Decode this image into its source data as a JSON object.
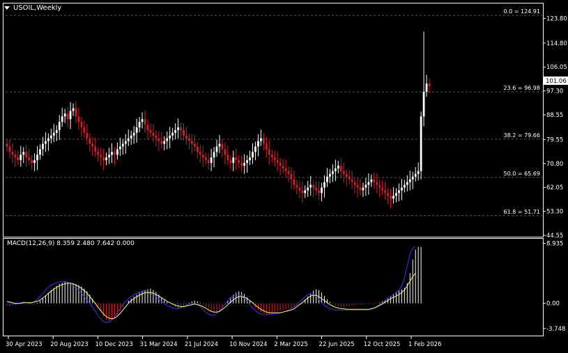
{
  "chart_title": "USOIL,Weekly",
  "macd_label": "MACD(12,26,9) 8.359 2.480 7.642 0.000",
  "colors": {
    "background": "#000000",
    "bull": "#ffffff",
    "bear": "#d0202a",
    "macd_line": "#2a3cff",
    "signal_line": "#ffff66",
    "grid": "#ffffff",
    "current_price_box": "#ffffff"
  },
  "chart_data": [
    {
      "type": "candlestick",
      "title": "USOIL,Weekly",
      "y_ticks": [
        "123.80",
        "114.80",
        "106.05",
        "97.30",
        "88.55",
        "79.55",
        "70.80",
        "62.05",
        "53.30",
        "44.55"
      ],
      "ylim": [
        44.55,
        128.5
      ],
      "current_price": "101.06",
      "x_ticks": [
        "30 Apr 2023",
        "20 Aug 2023",
        "10 Dec 2023",
        "31 Mar 2024",
        "21 Jul 2024",
        "10 Nov 2024",
        "2 Mar 2025",
        "22 Jun 2025",
        "12 Oct 2025",
        "1 Feb 2026"
      ],
      "fibonacci_levels": [
        {
          "label": "0.0 = 124.91",
          "value": 124.91
        },
        {
          "label": "23.6 = 96.98",
          "value": 96.98
        },
        {
          "label": "38.2 = 79.66",
          "value": 79.66
        },
        {
          "label": "50.0 = 65.69",
          "value": 65.69
        },
        {
          "label": "61.8 = 51.71",
          "value": 51.71
        }
      ],
      "close": [
        77,
        75,
        74,
        73,
        72,
        74,
        75,
        73,
        72,
        71,
        72,
        74,
        76,
        78,
        79,
        80,
        81,
        82,
        83,
        86,
        88,
        89,
        87,
        90,
        91,
        88,
        86,
        84,
        82,
        80,
        78,
        77,
        75,
        74,
        73,
        72,
        73,
        74,
        75,
        74,
        76,
        77,
        78,
        79,
        80,
        81,
        82,
        84,
        86,
        87,
        85,
        83,
        82,
        81,
        80,
        79,
        78,
        79,
        80,
        81,
        82,
        83,
        84,
        83,
        81,
        80,
        79,
        78,
        77,
        75,
        74,
        73,
        72,
        71,
        73,
        75,
        77,
        78,
        76,
        74,
        72,
        71,
        73,
        72,
        71,
        70,
        71,
        72,
        73,
        75,
        77,
        79,
        80,
        78,
        76,
        74,
        73,
        72,
        71,
        70,
        69,
        68,
        67,
        65,
        63,
        62,
        61,
        60,
        61,
        62,
        63,
        62,
        61,
        60,
        62,
        64,
        66,
        67,
        68,
        69,
        70,
        68,
        67,
        66,
        65,
        64,
        63,
        62,
        61,
        62,
        63,
        64,
        65,
        64,
        63,
        62,
        61,
        60,
        59,
        58,
        59,
        60,
        61,
        62,
        63,
        64,
        65,
        66,
        67,
        68,
        88,
        97,
        100,
        99
      ],
      "spikes": {
        "151": 119,
        "152": 102
      }
    },
    {
      "type": "macd",
      "parameters": "MACD(12,26,9)",
      "values": {
        "histogram": 8.359,
        "signal": 2.48,
        "macd": 7.642,
        "zero": 0.0
      },
      "y_ticks": [
        "8.935",
        "0.00",
        "-3.748"
      ],
      "ylim": [
        -4.6,
        9.3
      ],
      "histogram": [
        -0.3,
        -0.4,
        -0.3,
        -0.2,
        -0.1,
        0.0,
        0.1,
        0.0,
        -0.1,
        -0.2,
        -0.1,
        0.1,
        0.4,
        0.8,
        1.2,
        1.6,
        2.0,
        2.3,
        2.6,
        2.9,
        3.1,
        3.3,
        3.2,
        3.1,
        3.0,
        2.9,
        2.7,
        2.5,
        2.2,
        1.8,
        1.3,
        0.7,
        0.1,
        -0.5,
        -1.2,
        -1.9,
        -2.4,
        -2.6,
        -2.5,
        -2.2,
        -1.7,
        -1.1,
        -0.5,
        0.0,
        0.4,
        0.7,
        1.0,
        1.3,
        1.6,
        1.8,
        2.0,
        2.1,
        2.2,
        2.0,
        1.7,
        1.3,
        0.9,
        0.5,
        0.2,
        0.0,
        -0.3,
        -0.6,
        -0.8,
        -0.7,
        -0.5,
        -0.2,
        0.1,
        0.3,
        0.4,
        0.3,
        0.1,
        -0.2,
        -0.5,
        -0.9,
        -1.2,
        -1.4,
        -1.3,
        -1.0,
        -0.6,
        -0.1,
        0.4,
        0.9,
        1.3,
        1.6,
        1.8,
        1.7,
        1.4,
        0.9,
        0.4,
        -0.1,
        -0.6,
        -1.0,
        -1.3,
        -1.5,
        -1.6,
        -1.5,
        -1.4,
        -1.3,
        -1.2,
        -1.1,
        -1.0,
        -0.9,
        -0.8,
        -0.7,
        -0.6,
        -0.4,
        -0.2,
        0.1,
        0.5,
        1.0,
        1.5,
        1.9,
        2.1,
        2.0,
        1.6,
        1.1,
        0.6,
        0.2,
        -0.1,
        -0.3,
        -0.5,
        -0.6,
        -0.6,
        -0.5,
        -0.4,
        -0.3,
        -0.3,
        -0.2,
        -0.2,
        -0.2,
        -0.1,
        -0.1,
        -0.1,
        -0.1,
        0.0,
        0.1,
        0.3,
        0.5,
        0.8,
        1.1,
        1.4,
        1.7,
        1.9,
        2.1,
        2.3,
        3.0,
        4.5,
        6.5,
        8.0,
        8.4,
        8.4
      ],
      "macd_line": [
        0.2,
        0.1,
        0.0,
        -0.1,
        0.0,
        0.1,
        0.2,
        0.1,
        0.0,
        0.1,
        0.3,
        0.6,
        1.0,
        1.5,
        2.0,
        2.4,
        2.7,
        2.9,
        3.1,
        3.2,
        3.3,
        3.2,
        3.1,
        2.9,
        2.6,
        2.3,
        1.9,
        1.5,
        1.0,
        0.5,
        0.0,
        -0.6,
        -1.2,
        -1.8,
        -2.3,
        -2.7,
        -2.9,
        -2.8,
        -2.5,
        -2.0,
        -1.4,
        -0.8,
        -0.2,
        0.3,
        0.7,
        1.0,
        1.3,
        1.5,
        1.7,
        1.8,
        1.9,
        1.8,
        1.6,
        1.3,
        1.0,
        0.6,
        0.3,
        0.0,
        -0.3,
        -0.5,
        -0.7,
        -0.8,
        -0.8,
        -0.7,
        -0.5,
        -0.3,
        -0.1,
        0.0,
        0.0,
        -0.2,
        -0.5,
        -0.9,
        -1.3,
        -1.6,
        -1.8,
        -1.8,
        -1.5,
        -1.1,
        -0.6,
        -0.1,
        0.4,
        0.8,
        1.1,
        1.3,
        1.3,
        1.1,
        0.7,
        0.3,
        -0.2,
        -0.7,
        -1.1,
        -1.4,
        -1.6,
        -1.7,
        -1.7,
        -1.6,
        -1.6,
        -1.5,
        -1.5,
        -1.4,
        -1.3,
        -1.2,
        -1.0,
        -0.8,
        -0.5,
        -0.2,
        0.2,
        0.6,
        1.0,
        1.3,
        1.4,
        1.3,
        1.0,
        0.6,
        0.1,
        -0.3,
        -0.6,
        -0.8,
        -0.9,
        -1.0,
        -1.0,
        -1.0,
        -1.0,
        -1.0,
        -1.0,
        -1.0,
        -1.0,
        -1.0,
        -1.0,
        -1.0,
        -1.0,
        -1.0,
        -0.9,
        -0.7,
        -0.5,
        -0.2,
        0.1,
        0.4,
        0.7,
        1.0,
        1.3,
        1.6,
        2.0,
        2.6,
        3.8,
        5.6,
        7.4,
        8.2,
        8.4
      ],
      "signal_line": [
        0.3,
        0.2,
        0.1,
        0.0,
        0.0,
        0.0,
        0.1,
        0.1,
        0.1,
        0.1,
        0.2,
        0.3,
        0.5,
        0.8,
        1.1,
        1.5,
        1.8,
        2.1,
        2.4,
        2.6,
        2.8,
        2.9,
        3.0,
        3.0,
        2.9,
        2.7,
        2.5,
        2.2,
        1.9,
        1.5,
        1.0,
        0.5,
        0.0,
        -0.6,
        -1.1,
        -1.6,
        -2.0,
        -2.2,
        -2.3,
        -2.2,
        -1.9,
        -1.5,
        -1.0,
        -0.5,
        0.0,
        0.4,
        0.7,
        1.0,
        1.2,
        1.4,
        1.6,
        1.6,
        1.6,
        1.5,
        1.3,
        1.1,
        0.8,
        0.6,
        0.3,
        0.1,
        -0.1,
        -0.3,
        -0.4,
        -0.5,
        -0.5,
        -0.4,
        -0.3,
        -0.2,
        -0.1,
        -0.2,
        -0.3,
        -0.5,
        -0.7,
        -1.0,
        -1.2,
        -1.3,
        -1.3,
        -1.2,
        -0.9,
        -0.6,
        -0.2,
        0.2,
        0.5,
        0.8,
        1.0,
        1.0,
        0.9,
        0.7,
        0.4,
        0.1,
        -0.3,
        -0.6,
        -0.9,
        -1.1,
        -1.3,
        -1.4,
        -1.4,
        -1.4,
        -1.4,
        -1.4,
        -1.3,
        -1.2,
        -1.1,
        -1.0,
        -0.8,
        -0.5,
        -0.2,
        0.1,
        0.5,
        0.8,
        1.1,
        1.2,
        1.2,
        1.0,
        0.7,
        0.4,
        0.1,
        -0.2,
        -0.4,
        -0.6,
        -0.7,
        -0.8,
        -0.8,
        -0.9,
        -0.9,
        -0.9,
        -0.9,
        -0.9,
        -0.9,
        -0.9,
        -0.9,
        -0.9,
        -0.8,
        -0.7,
        -0.5,
        -0.3,
        -0.1,
        0.2,
        0.4,
        0.7,
        0.9,
        1.1,
        1.3,
        1.6,
        2.0,
        2.6,
        3.3,
        4.0,
        4.5
      ]
    }
  ]
}
